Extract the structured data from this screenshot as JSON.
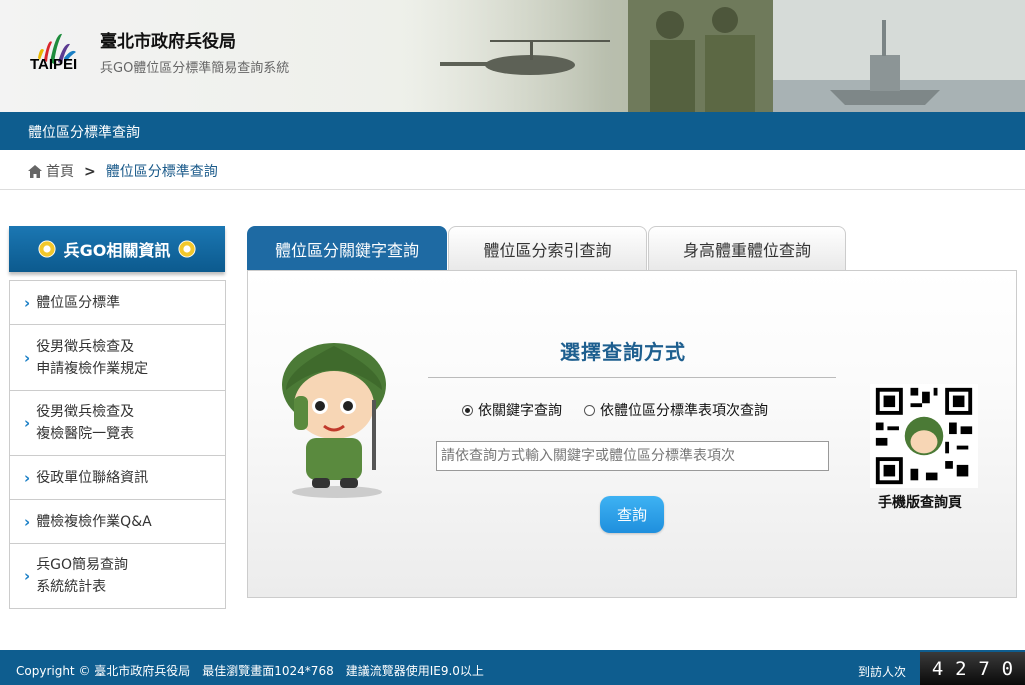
{
  "header": {
    "logo_text": "TAIPEI",
    "org_name": "臺北市政府兵役局",
    "system_name": "兵GO體位區分標準簡易查詢系統"
  },
  "titlebar": {
    "label": "體位區分標準查詢"
  },
  "breadcrumb": {
    "home": "首頁",
    "separator": ">",
    "current": "體位區分標準查詢"
  },
  "sidebar": {
    "title": "兵GO相關資訊",
    "items": [
      {
        "line1": "體位區分標準",
        "line2": ""
      },
      {
        "line1": "役男徵兵檢查及",
        "line2": "申請複檢作業規定"
      },
      {
        "line1": "役男徵兵檢查及",
        "line2": "複檢醫院一覽表"
      },
      {
        "line1": "役政單位聯絡資訊",
        "line2": ""
      },
      {
        "line1": "體檢複檢作業Q&A",
        "line2": ""
      },
      {
        "line1": "兵GO簡易查詢",
        "line2": "系統統計表"
      }
    ]
  },
  "tabs": [
    {
      "label": "體位區分關鍵字查詢",
      "active": true
    },
    {
      "label": "體位區分索引查詢",
      "active": false
    },
    {
      "label": "身高體重體位查詢",
      "active": false
    }
  ],
  "search": {
    "heading": "選擇查詢方式",
    "option_keyword": "依關鍵字查詢",
    "option_index": "依體位區分標準表項次查詢",
    "selected": "keyword",
    "input_value": "",
    "placeholder": "請依查詢方式輸入關鍵字或體位區分標準表項次",
    "button_label": "查詢"
  },
  "qr": {
    "label": "手機版查詢頁"
  },
  "footer": {
    "copyright": "Copyright © 臺北市政府兵役局　最佳瀏覽畫面1024*768　建議流覽器使用IE9.0以上",
    "visitor_label": "到訪人次",
    "counter_digits": [
      "4",
      "2",
      "7",
      "0"
    ]
  },
  "colors": {
    "primary": "#0e5d8f",
    "tab_active": "#1e6aa3",
    "button": "#2a9ee8",
    "heading": "#1e5f8f"
  }
}
